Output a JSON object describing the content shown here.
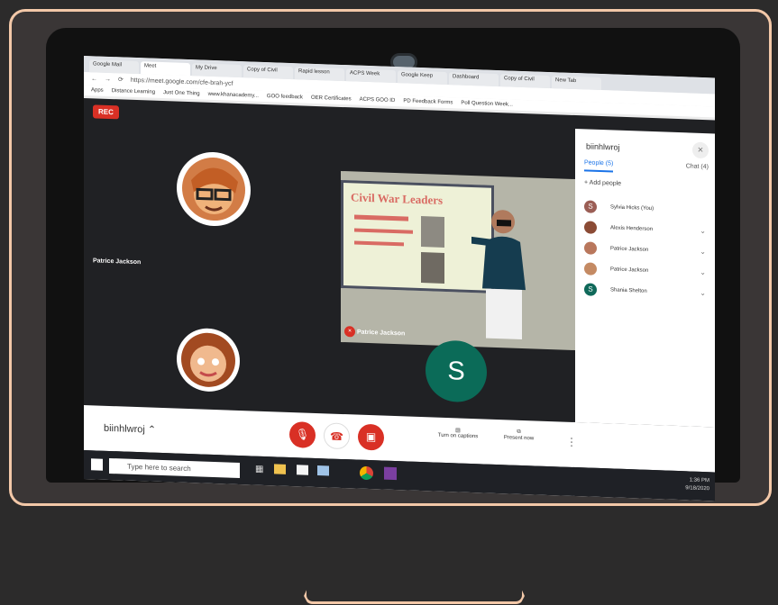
{
  "browser": {
    "tabs": [
      "Google Mail",
      "Meet",
      "My Drive",
      "Copy of Civil",
      "Rapid lesson",
      "ACPS Week",
      "Google Keep",
      "Dashboard",
      "Copy of Civil",
      "New Tab"
    ],
    "url": "https://meet.google.com/cfe-brah-ycf",
    "bookmarks": [
      "Apps",
      "Distance Learning",
      "Just One Thing",
      "www.khanacademy...",
      "GOO feedback",
      "OER Certificates",
      "ACPS GOO ID",
      "PD Feedback Forms",
      "Poll Question Week..."
    ]
  },
  "meeting": {
    "recording_label": "REC",
    "participants_tile_name": "Patrice Jackson",
    "presenter_name": "Patrice Jackson",
    "slide_title": "Civil War Leaders",
    "avatar_initial": "S",
    "meeting_code": "biinhlwroj",
    "captions_label": "Turn on captions",
    "present_label": "Present now"
  },
  "people_panel": {
    "title": "biinhlwroj",
    "people_tab": "People (5)",
    "chat_tab": "Chat (4)",
    "add_people": "Add people",
    "participants": [
      {
        "name": "Sylvia Hicks (You)",
        "initial": "S",
        "color": "#9b5e55"
      },
      {
        "name": "Alexis Henderson",
        "initial": "",
        "color": "#8b4b35"
      },
      {
        "name": "Patrice Jackson",
        "initial": "",
        "color": "#b9775c"
      },
      {
        "name": "Patrice Jackson",
        "initial": "",
        "color": "#c48a63"
      },
      {
        "name": "Shania Shelton",
        "initial": "S",
        "color": "#10695a"
      }
    ]
  },
  "taskbar": {
    "search_placeholder": "Type here to search",
    "time": "1:36 PM",
    "date": "9/18/2020"
  }
}
